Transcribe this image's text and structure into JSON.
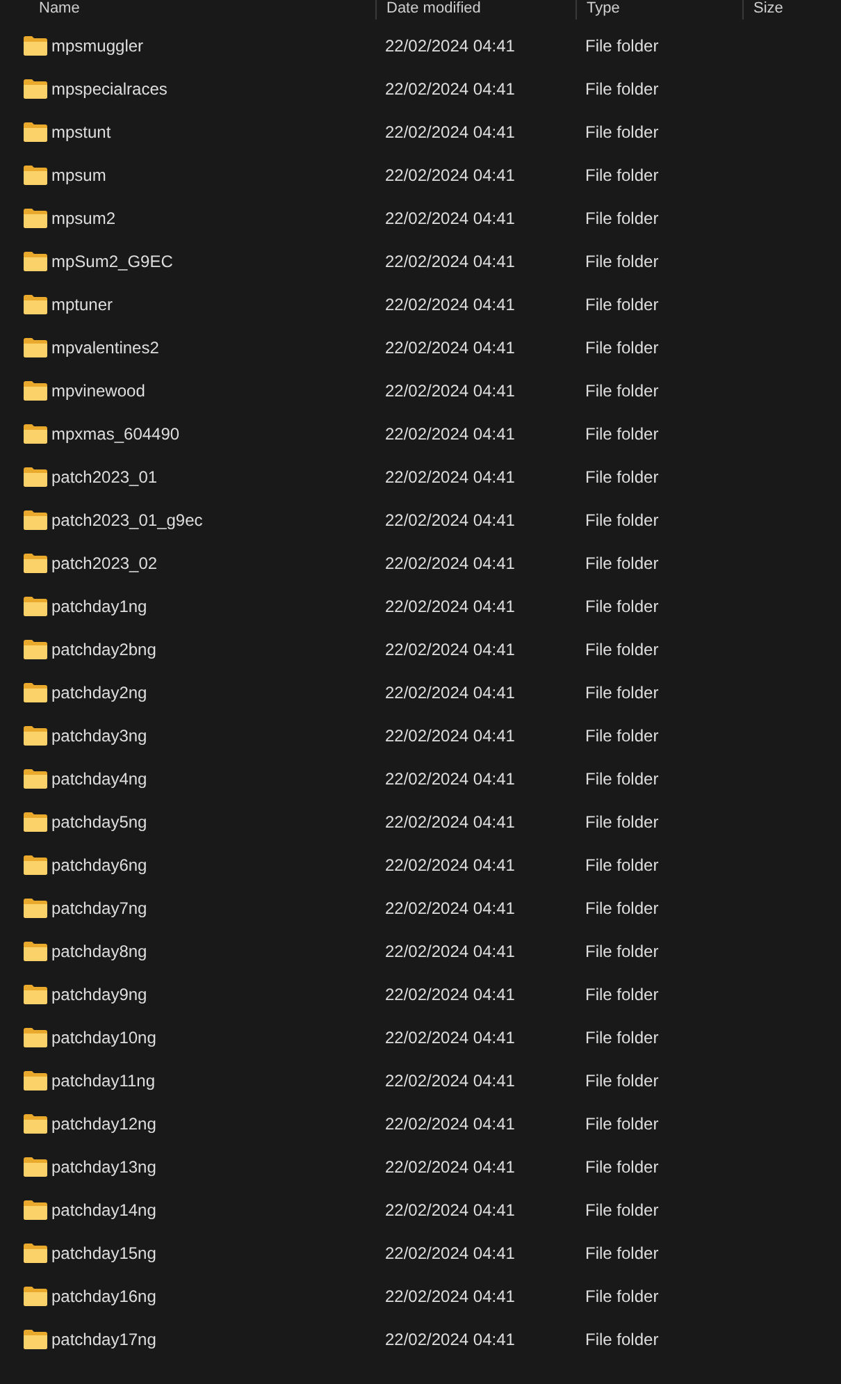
{
  "table": {
    "columns": [
      "Name",
      "Date modified",
      "Type",
      "Size"
    ],
    "rows": [
      {
        "name": "mpsmuggler",
        "date": "22/02/2024 04:41",
        "type": "File folder"
      },
      {
        "name": "mpspecialraces",
        "date": "22/02/2024 04:41",
        "type": "File folder"
      },
      {
        "name": "mpstunt",
        "date": "22/02/2024 04:41",
        "type": "File folder"
      },
      {
        "name": "mpsum",
        "date": "22/02/2024 04:41",
        "type": "File folder"
      },
      {
        "name": "mpsum2",
        "date": "22/02/2024 04:41",
        "type": "File folder"
      },
      {
        "name": "mpSum2_G9EC",
        "date": "22/02/2024 04:41",
        "type": "File folder"
      },
      {
        "name": "mptuner",
        "date": "22/02/2024 04:41",
        "type": "File folder"
      },
      {
        "name": "mpvalentines2",
        "date": "22/02/2024 04:41",
        "type": "File folder"
      },
      {
        "name": "mpvinewood",
        "date": "22/02/2024 04:41",
        "type": "File folder"
      },
      {
        "name": "mpxmas_604490",
        "date": "22/02/2024 04:41",
        "type": "File folder"
      },
      {
        "name": "patch2023_01",
        "date": "22/02/2024 04:41",
        "type": "File folder"
      },
      {
        "name": "patch2023_01_g9ec",
        "date": "22/02/2024 04:41",
        "type": "File folder"
      },
      {
        "name": "patch2023_02",
        "date": "22/02/2024 04:41",
        "type": "File folder"
      },
      {
        "name": "patchday1ng",
        "date": "22/02/2024 04:41",
        "type": "File folder"
      },
      {
        "name": "patchday2bng",
        "date": "22/02/2024 04:41",
        "type": "File folder"
      },
      {
        "name": "patchday2ng",
        "date": "22/02/2024 04:41",
        "type": "File folder"
      },
      {
        "name": "patchday3ng",
        "date": "22/02/2024 04:41",
        "type": "File folder"
      },
      {
        "name": "patchday4ng",
        "date": "22/02/2024 04:41",
        "type": "File folder"
      },
      {
        "name": "patchday5ng",
        "date": "22/02/2024 04:41",
        "type": "File folder"
      },
      {
        "name": "patchday6ng",
        "date": "22/02/2024 04:41",
        "type": "File folder"
      },
      {
        "name": "patchday7ng",
        "date": "22/02/2024 04:41",
        "type": "File folder"
      },
      {
        "name": "patchday8ng",
        "date": "22/02/2024 04:41",
        "type": "File folder"
      },
      {
        "name": "patchday9ng",
        "date": "22/02/2024 04:41",
        "type": "File folder"
      },
      {
        "name": "patchday10ng",
        "date": "22/02/2024 04:41",
        "type": "File folder"
      },
      {
        "name": "patchday11ng",
        "date": "22/02/2024 04:41",
        "type": "File folder"
      },
      {
        "name": "patchday12ng",
        "date": "22/02/2024 04:41",
        "type": "File folder"
      },
      {
        "name": "patchday13ng",
        "date": "22/02/2024 04:41",
        "type": "File folder"
      },
      {
        "name": "patchday14ng",
        "date": "22/02/2024 04:41",
        "type": "File folder"
      },
      {
        "name": "patchday15ng",
        "date": "22/02/2024 04:41",
        "type": "File folder"
      },
      {
        "name": "patchday16ng",
        "date": "22/02/2024 04:41",
        "type": "File folder"
      },
      {
        "name": "patchday17ng",
        "date": "22/02/2024 04:41",
        "type": "File folder"
      }
    ]
  }
}
